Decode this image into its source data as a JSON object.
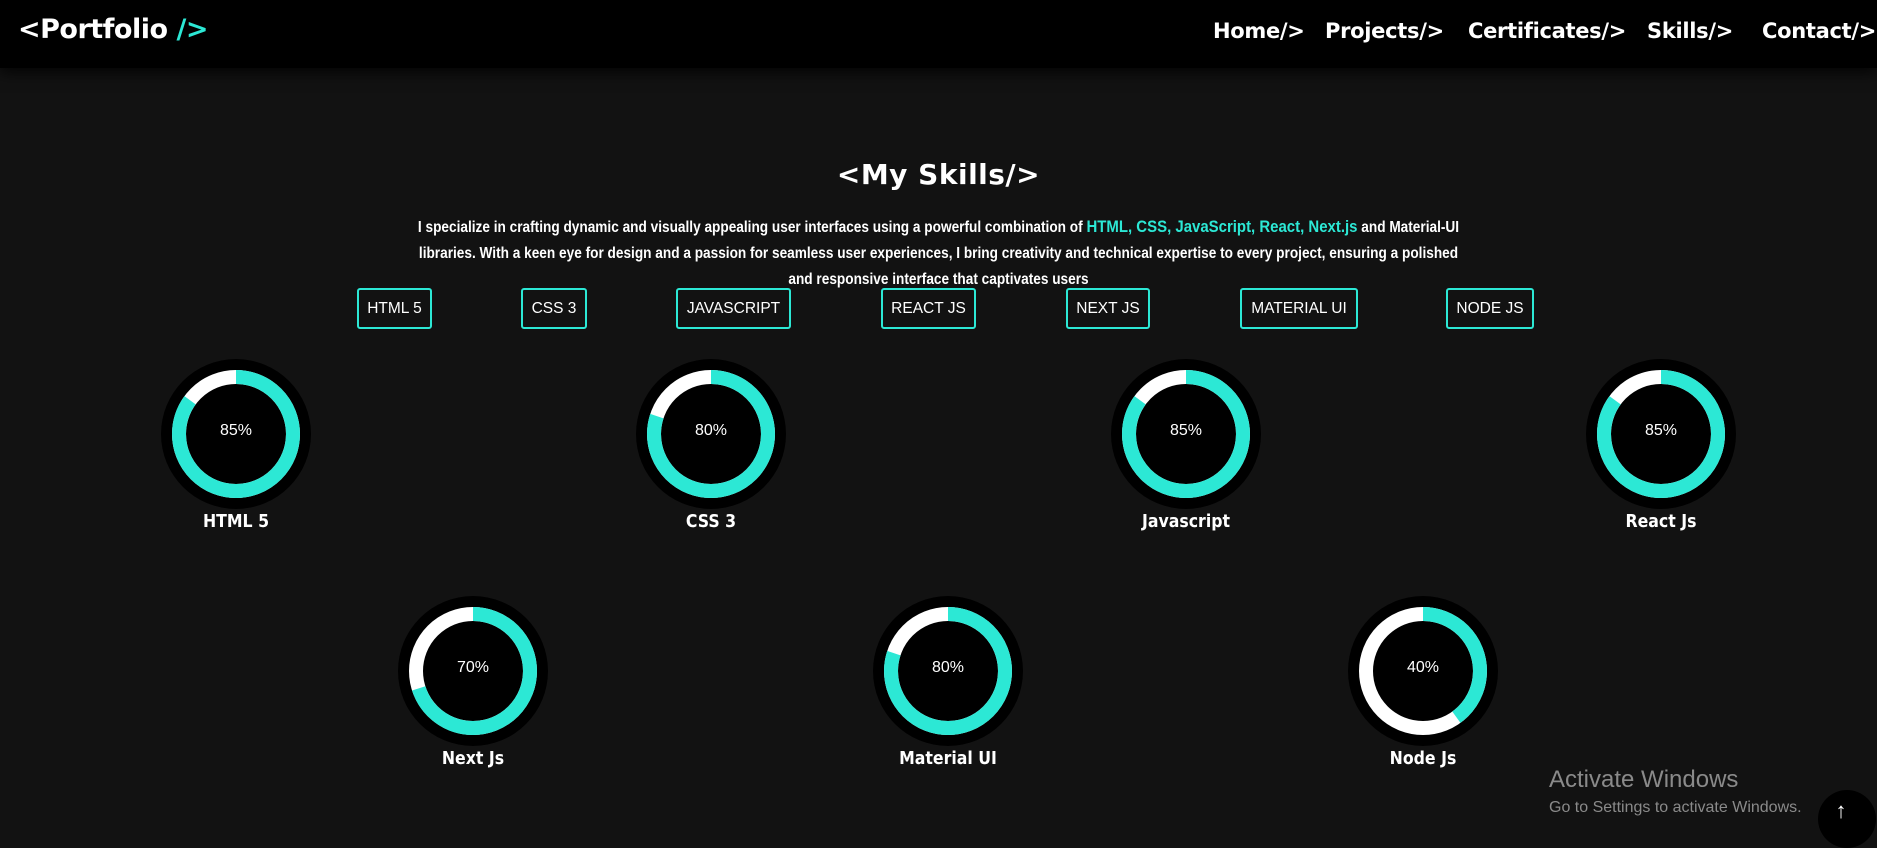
{
  "nav": {
    "logo_prefix": "<Portfolio ",
    "logo_accent": "/>",
    "links": [
      "Home/>",
      "Projects/>",
      "Certificates/>",
      "Skills/>",
      "Contact/>"
    ]
  },
  "section": {
    "heading": "<My Skills/>",
    "intro_before": "I specialize in crafting dynamic and visually appealing user interfaces using a powerful combination of ",
    "intro_highlight": "HTML, CSS, JavaScript, React, Next.js",
    "intro_after": " and Material-UI libraries. With a keen eye for design and a passion for seamless user experiences, I bring creativity and technical expertise to every project, ensuring a polished and responsive interface that captivates users"
  },
  "tags": [
    "HTML 5",
    "CSS 3",
    "JAVASCRIPT",
    "REACT JS",
    "NEXT JS",
    "MATERIAL UI",
    "NODE JS"
  ],
  "skills": [
    {
      "name": "HTML 5",
      "label": "85%",
      "percent": 85
    },
    {
      "name": "CSS 3",
      "label": "80%",
      "percent": 80
    },
    {
      "name": "Javascript",
      "label": "85%",
      "percent": 85
    },
    {
      "name": "React Js",
      "label": "85%",
      "percent": 85
    },
    {
      "name": "Next Js",
      "label": "70%",
      "percent": 70
    },
    {
      "name": "Material UI",
      "label": "80%",
      "percent": 80
    },
    {
      "name": "Node Js",
      "label": "40%",
      "percent": 40
    }
  ],
  "colors": {
    "accent": "#2ce8d5",
    "track": "#ffffff",
    "background": "#121212"
  },
  "watermark": {
    "title": "Activate Windows",
    "subtitle": "Go to Settings to activate Windows."
  },
  "scroll_top_icon": "arrow-up-icon"
}
